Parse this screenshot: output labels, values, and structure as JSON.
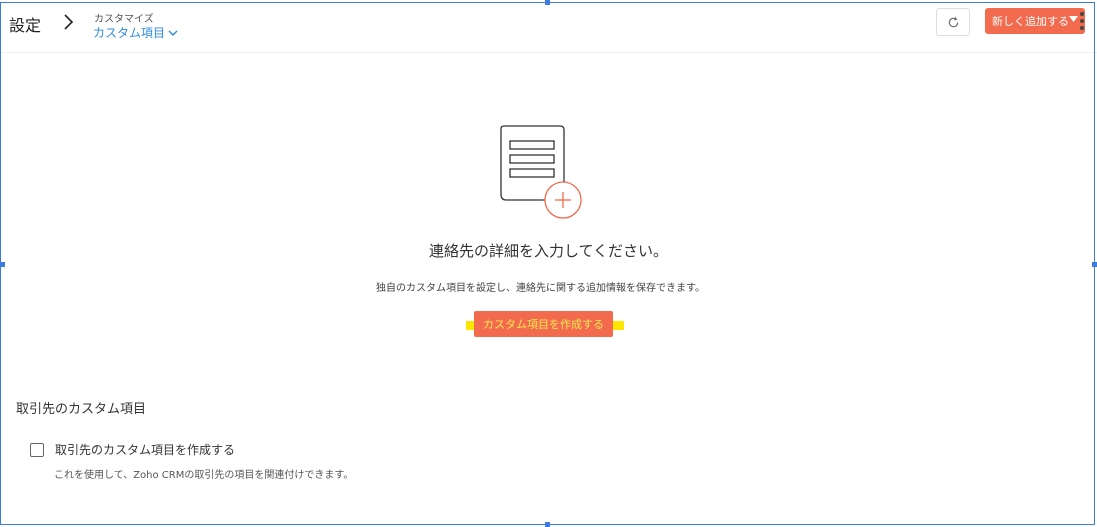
{
  "header": {
    "title": "設定",
    "breadcrumb_parent": "カスタマイズ",
    "breadcrumb_current": "カスタム項目",
    "add_button_label": "新しく追加する"
  },
  "empty_state": {
    "heading": "連絡先の詳細を入力してください。",
    "description": "独自のカスタム項目を設定し、連絡先に関する追加情報を保存できます。",
    "create_button_label": "カスタム項目を作成する"
  },
  "accounts_section": {
    "heading": "取引先のカスタム項目",
    "checkbox_label": "取引先のカスタム項目を作成する",
    "checkbox_checked": false,
    "hint": "これを使用して、Zoho CRMの取引先の項目を関連付けできます。"
  },
  "colors": {
    "accent": "#f26b4f",
    "link": "#2d8ce0",
    "highlight": "#ffe600",
    "selection": "#3b7be0"
  },
  "icons": [
    "chevron-right-icon",
    "chevron-down-icon",
    "refresh-icon",
    "caret-down-icon",
    "kebab-menu-icon",
    "document-add-illustration"
  ]
}
